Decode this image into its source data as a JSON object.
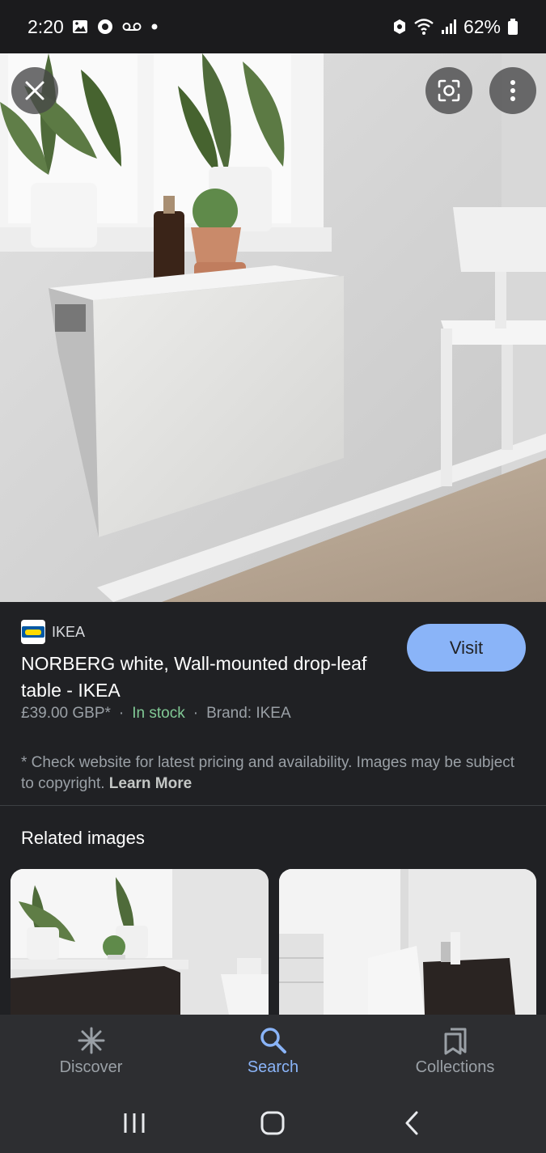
{
  "status_bar": {
    "time": "2:20",
    "battery": "62%",
    "left_icons": [
      "gallery-icon",
      "bixby-icon",
      "voicemail-icon",
      "dot-icon"
    ],
    "right_icons": [
      "data-saver-icon",
      "wifi-icon",
      "signal-icon",
      "battery-icon"
    ]
  },
  "viewer": {
    "buttons": [
      "close-icon",
      "lens-icon",
      "more-vert-icon"
    ]
  },
  "result": {
    "source": "IKEA",
    "title": "NORBERG white, Wall-mounted drop-leaf table - IKEA",
    "price": "£39.00 GBP*",
    "separator": "·",
    "stock": "In stock",
    "brand": "Brand: IKEA",
    "visit_label": "Visit",
    "disclaimer": "* Check website for latest pricing and availability. Images may be subject to copyright.",
    "learn_more": "Learn More"
  },
  "related": {
    "title": "Related images"
  },
  "bottom_nav": {
    "items": [
      {
        "label": "Discover",
        "icon": "asterisk-icon",
        "active": false
      },
      {
        "label": "Search",
        "icon": "search-icon",
        "active": true
      },
      {
        "label": "Collections",
        "icon": "collections-icon",
        "active": false
      }
    ]
  },
  "system_nav": [
    "recents-icon",
    "home-icon",
    "back-icon"
  ],
  "colors": {
    "background": "#202124",
    "accent": "#8ab4f8",
    "in_stock": "#81c995",
    "muted_text": "#9aa0a6"
  }
}
